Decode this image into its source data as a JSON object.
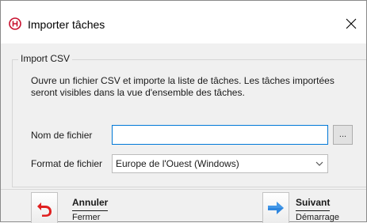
{
  "window": {
    "title": "Importer tâches",
    "close_symbol": "×",
    "app_icon": "app-logo-icon"
  },
  "group": {
    "legend": "Import CSV",
    "description": "Ouvre un fichier CSV et importe la liste de tâches. Les tâches importées seront visibles dans la vue d'ensemble des tâches."
  },
  "form": {
    "filename_label": "Nom de fichier",
    "filename_value": "",
    "browse_label": "...",
    "format_label": "Format de fichier",
    "format_value": "Europe de l'Ouest (Windows)"
  },
  "footer": {
    "cancel": {
      "title": "Annuler",
      "subtitle": "Fermer",
      "icon": "undo-arrow-icon"
    },
    "next": {
      "title": "Suivant",
      "subtitle": "Démarrage",
      "icon": "right-arrow-icon"
    }
  },
  "colors": {
    "accent": "#0078d7",
    "cancel_icon": "#e02020",
    "next_icon": "#2e86de",
    "logo": "#c8102e"
  }
}
